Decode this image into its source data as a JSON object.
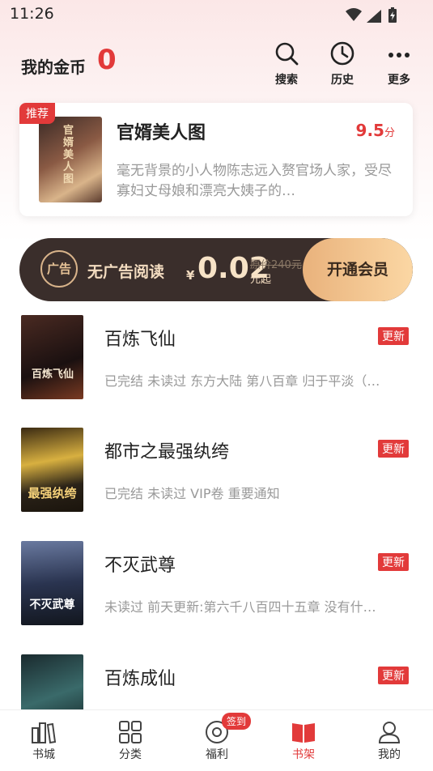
{
  "status": {
    "time": "11:26"
  },
  "header": {
    "coins_label": "我的金币",
    "coins_value": "0",
    "actions": [
      {
        "label": "搜索",
        "icon": "search-icon"
      },
      {
        "label": "历史",
        "icon": "clock-icon"
      },
      {
        "label": "更多",
        "icon": "more-icon"
      }
    ]
  },
  "recommend": {
    "badge": "推荐",
    "title": "官婿美人图",
    "score": "9.5",
    "score_unit": "分",
    "desc": "毫无背景的小人物陈志远入赘官场人家，受尽寡妇丈母娘和漂亮大姨子的…",
    "cover_text": "官婿美人图"
  },
  "vip": {
    "icon_text": "广告",
    "text": "无广告阅读",
    "yen": "¥",
    "price": "0.02",
    "orig": "原价240元",
    "unit": "元起",
    "button": "开通会员"
  },
  "books": [
    {
      "title": "百炼飞仙",
      "badge": "更新",
      "desc": "已完结 未读过 东方大陆 第八百章 归于平淡（…",
      "cover_text": "百炼飞仙",
      "cover_color": "#2a1c17"
    },
    {
      "title": "都市之最强纨绔",
      "badge": "更新",
      "desc": "已完结 未读过 VIP卷 重要通知",
      "cover_text": "最强纨绔",
      "cover_color": "#c9a23a"
    },
    {
      "title": "不灭武尊",
      "badge": "更新",
      "desc": "未读过 前天更新:第六千八百四十五章 没有什…",
      "cover_text": "不灭武尊",
      "cover_color": "#3b4b6a"
    },
    {
      "title": "百炼成仙",
      "badge": "更新",
      "desc": "",
      "cover_text": "",
      "cover_color": "#1e3a3a"
    }
  ],
  "tabs": [
    {
      "label": "书城",
      "icon": "bookstore-icon"
    },
    {
      "label": "分类",
      "icon": "grid-icon"
    },
    {
      "label": "福利",
      "icon": "welfare-icon"
    },
    {
      "label": "书架",
      "icon": "bookshelf-icon"
    },
    {
      "label": "我的",
      "icon": "user-icon"
    }
  ],
  "sign_badge": "签到",
  "colors": {
    "accent": "#e23a3a",
    "vip_dark": "#3a2e2b",
    "vip_gold": "#f3dcc0"
  }
}
